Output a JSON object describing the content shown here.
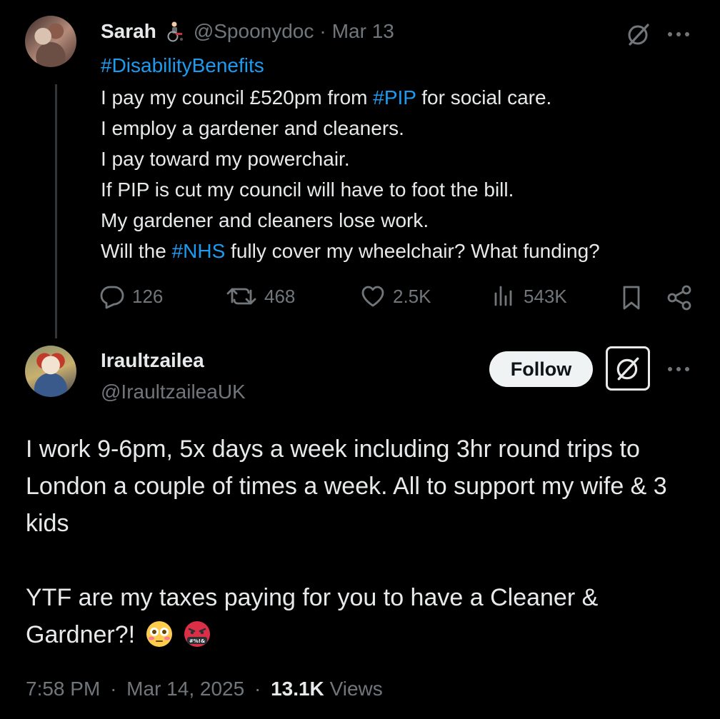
{
  "parent_tweet": {
    "author_name": "Sarah",
    "author_emoji": "wheelchair-person-emoji",
    "handle": "@Spoonydoc",
    "separator": "·",
    "date": "Mar 13",
    "hashtag_line": "#DisabilityBenefits",
    "lines": [
      {
        "parts": [
          {
            "text": "I pay my council £520pm from ",
            "tag": false
          },
          {
            "text": "#PIP",
            "tag": true
          },
          {
            "text": " for social care.",
            "tag": false
          }
        ]
      },
      {
        "parts": [
          {
            "text": "I employ a gardener and cleaners.",
            "tag": false
          }
        ]
      },
      {
        "parts": [
          {
            "text": "I pay toward my powerchair.",
            "tag": false
          }
        ]
      },
      {
        "parts": [
          {
            "text": "If PIP is cut my council will have to foot the bill.",
            "tag": false
          }
        ]
      },
      {
        "parts": [
          {
            "text": "My gardener and cleaners lose work.",
            "tag": false
          }
        ]
      },
      {
        "parts": [
          {
            "text": "Will the ",
            "tag": false
          },
          {
            "text": "#NHS",
            "tag": true
          },
          {
            "text": " fully cover my wheelchair? What funding?",
            "tag": false
          }
        ]
      }
    ],
    "actions": {
      "replies": "126",
      "reposts": "468",
      "likes": "2.5K",
      "views": "543K"
    }
  },
  "reply_tweet": {
    "author_name": "Iraultzailea",
    "handle": "@IraultzaileaUK",
    "follow_label": "Follow",
    "body_paragraph_1": "I work 9-6pm, 5x days a week including 3hr round trips to London a couple of times a week. All to support my wife & 3 kids",
    "body_paragraph_2": "YTF are my taxes paying for you to have a Cleaner & Gardner?!",
    "emojis": [
      "flushed-face-emoji",
      "swearing-face-emoji"
    ],
    "time": "7:58 PM",
    "separator": "·",
    "date": "Mar 14, 2025",
    "views_count": "13.1K",
    "views_label": "Views"
  },
  "colors": {
    "background": "#000000",
    "text": "#e7e9ea",
    "muted": "#71767b",
    "link": "#1d9bf0",
    "follow_bg": "#eff3f4"
  }
}
